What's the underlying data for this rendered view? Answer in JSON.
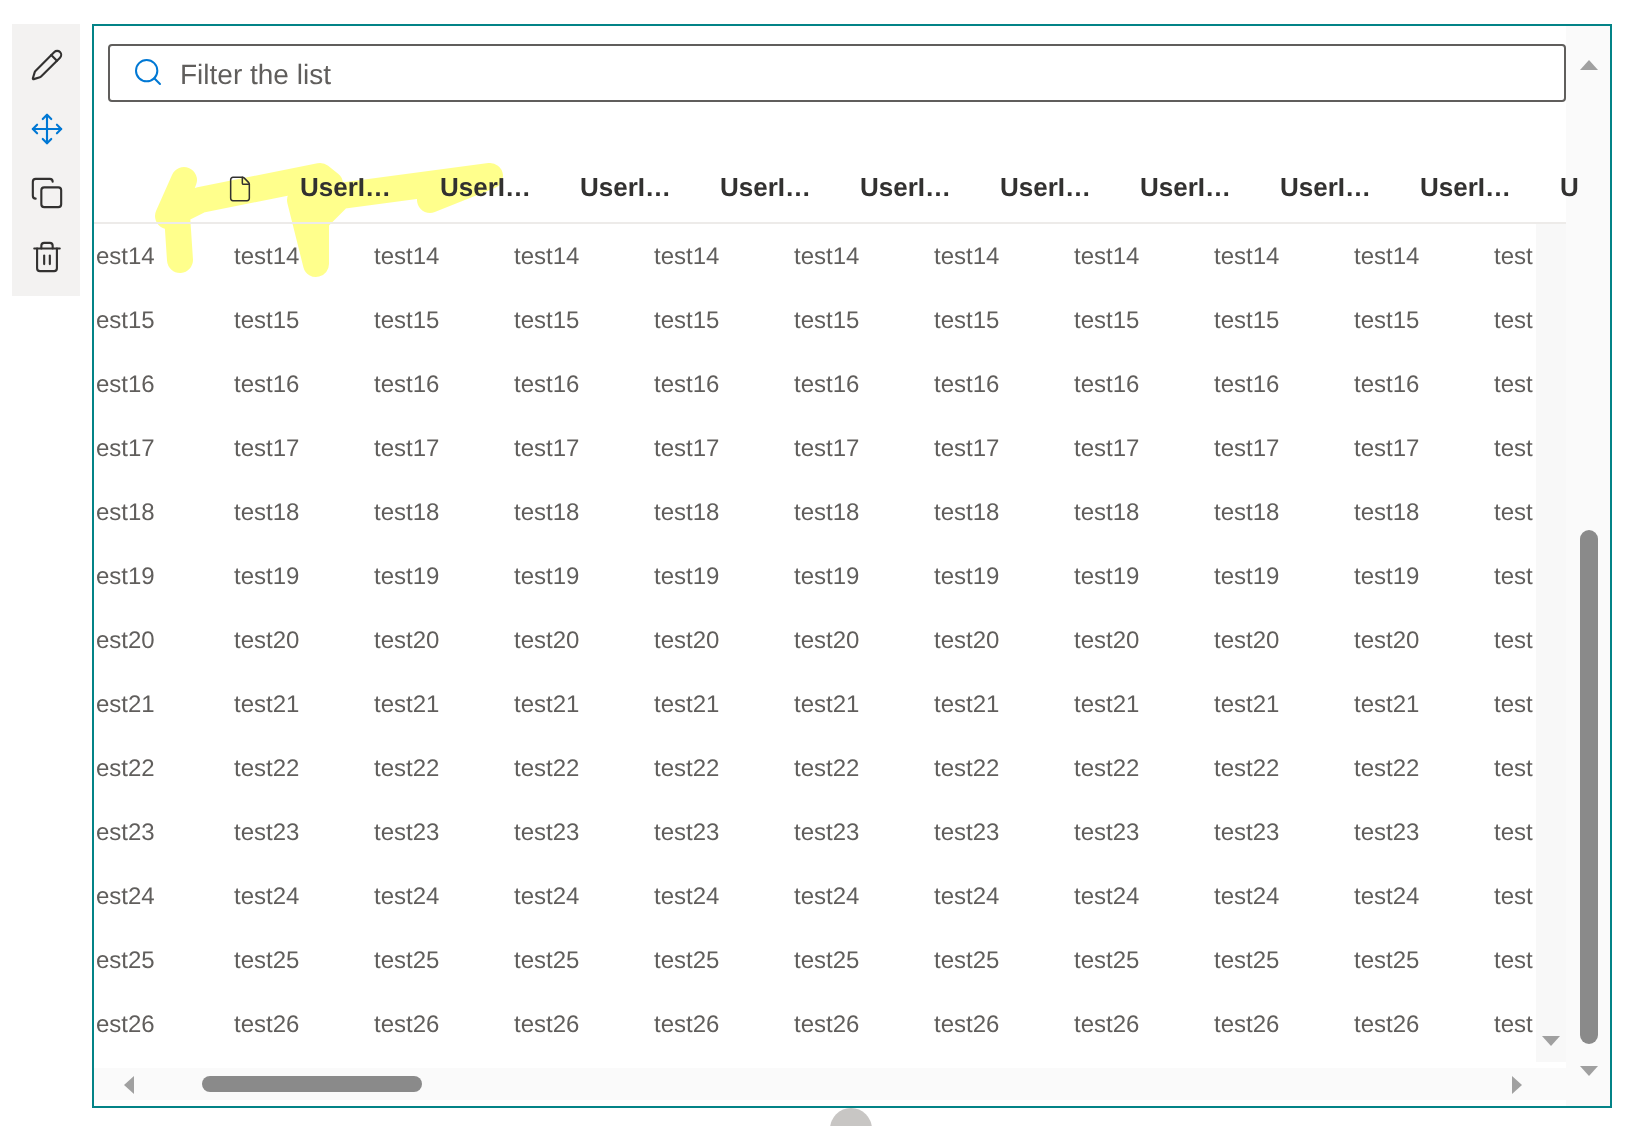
{
  "toolbar": [
    {
      "kind": "edit"
    },
    {
      "kind": "move"
    },
    {
      "kind": "copy"
    },
    {
      "kind": "delete"
    }
  ],
  "search": {
    "placeholder": "Filter the list"
  },
  "table": {
    "columns": [
      "UserI…",
      "UserI…",
      "UserI…",
      "UserI…",
      "UserI…",
      "UserI…",
      "UserI…",
      "UserI…",
      "UserI…",
      "U"
    ],
    "rows": [
      {
        "cells": [
          "est14",
          "test14",
          "test14",
          "test14",
          "test14",
          "test14",
          "test14",
          "test14",
          "test14",
          "test14",
          "test"
        ]
      },
      {
        "cells": [
          "est15",
          "test15",
          "test15",
          "test15",
          "test15",
          "test15",
          "test15",
          "test15",
          "test15",
          "test15",
          "test"
        ]
      },
      {
        "cells": [
          "est16",
          "test16",
          "test16",
          "test16",
          "test16",
          "test16",
          "test16",
          "test16",
          "test16",
          "test16",
          "test"
        ]
      },
      {
        "cells": [
          "est17",
          "test17",
          "test17",
          "test17",
          "test17",
          "test17",
          "test17",
          "test17",
          "test17",
          "test17",
          "test"
        ]
      },
      {
        "cells": [
          "est18",
          "test18",
          "test18",
          "test18",
          "test18",
          "test18",
          "test18",
          "test18",
          "test18",
          "test18",
          "test"
        ]
      },
      {
        "cells": [
          "est19",
          "test19",
          "test19",
          "test19",
          "test19",
          "test19",
          "test19",
          "test19",
          "test19",
          "test19",
          "test"
        ]
      },
      {
        "cells": [
          "est20",
          "test20",
          "test20",
          "test20",
          "test20",
          "test20",
          "test20",
          "test20",
          "test20",
          "test20",
          "test"
        ]
      },
      {
        "cells": [
          "est21",
          "test21",
          "test21",
          "test21",
          "test21",
          "test21",
          "test21",
          "test21",
          "test21",
          "test21",
          "test"
        ]
      },
      {
        "cells": [
          "est22",
          "test22",
          "test22",
          "test22",
          "test22",
          "test22",
          "test22",
          "test22",
          "test22",
          "test22",
          "test"
        ]
      },
      {
        "cells": [
          "est23",
          "test23",
          "test23",
          "test23",
          "test23",
          "test23",
          "test23",
          "test23",
          "test23",
          "test23",
          "test"
        ]
      },
      {
        "cells": [
          "est24",
          "test24",
          "test24",
          "test24",
          "test24",
          "test24",
          "test24",
          "test24",
          "test24",
          "test24",
          "test"
        ]
      },
      {
        "cells": [
          "est25",
          "test25",
          "test25",
          "test25",
          "test25",
          "test25",
          "test25",
          "test25",
          "test25",
          "test25",
          "test"
        ]
      },
      {
        "cells": [
          "est26",
          "test26",
          "test26",
          "test26",
          "test26",
          "test26",
          "test26",
          "test26",
          "test26",
          "test26",
          "test"
        ]
      }
    ]
  }
}
